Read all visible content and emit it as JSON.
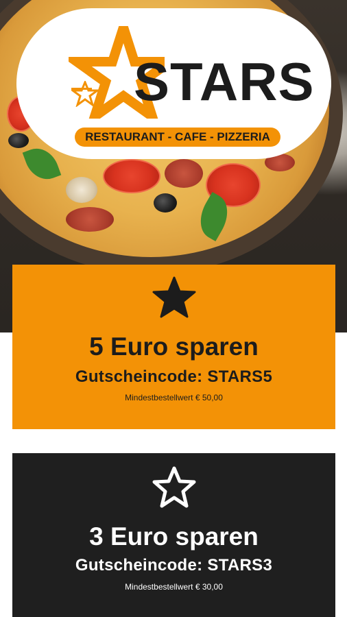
{
  "logo": {
    "name": "STARS",
    "tagline": "RESTAURANT - CAFE - PIZZERIA",
    "accent_color": "#f39206"
  },
  "vouchers": [
    {
      "icon": "star-filled-icon",
      "title": "5 Euro sparen",
      "code": "Gutscheincode: STARS5",
      "min_order": "Mindestbestellwert € 50,00",
      "background": "#f39206"
    },
    {
      "icon": "star-outline-icon",
      "title": "3 Euro sparen",
      "code": "Gutscheincode: STARS3",
      "min_order": "Mindestbestellwert € 30,00",
      "background": "#1f1f1f"
    }
  ]
}
